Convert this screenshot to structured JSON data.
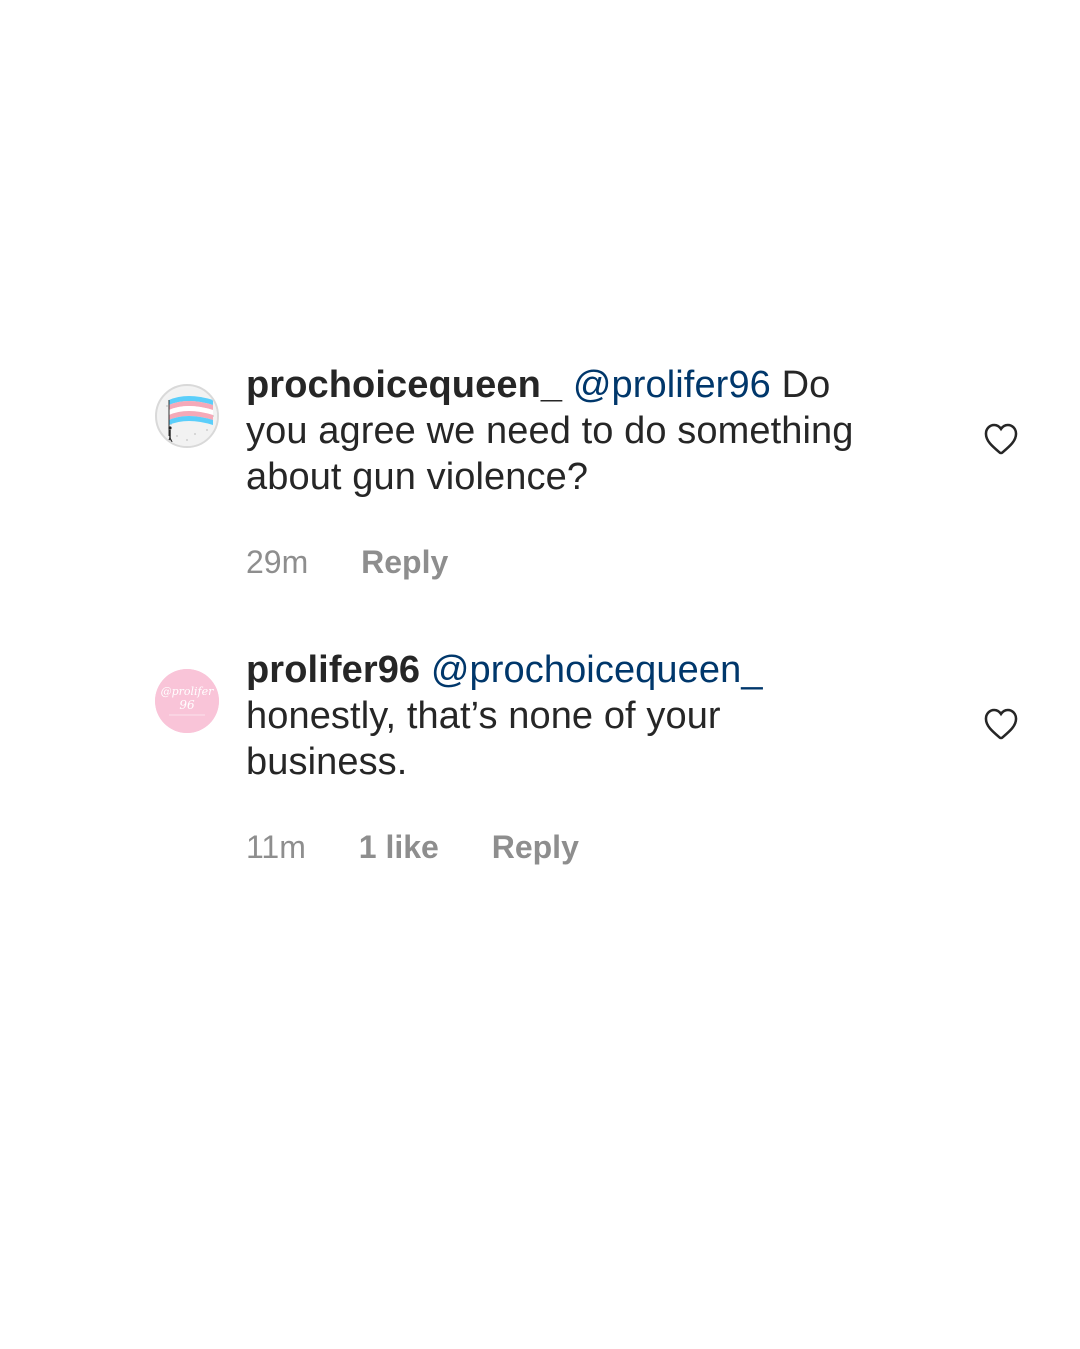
{
  "comments": [
    {
      "username": "prochoicequeen_",
      "mention": "@prolifer96",
      "text_line1_tail": "Do",
      "text_line2": "you agree we need to do something",
      "text_line3": "about gun violence?",
      "time": "29m",
      "reply_label": "Reply",
      "avatar_icon": "trans-flag-avatar-icon",
      "like_icon": "heart-outline-icon"
    },
    {
      "username": "prolifer96",
      "mention": "@prochoicequeen_",
      "text_line2": "honestly, that’s none of your",
      "text_line3": "business.",
      "time": "11m",
      "likes": "1 like",
      "reply_label": "Reply",
      "avatar_icon": "pink-logo-avatar-icon",
      "avatar_text": "@prolifer 96",
      "like_icon": "heart-outline-icon"
    }
  ],
  "colors": {
    "text": "#262626",
    "mention": "#00376b",
    "meta": "#8e8e8e",
    "avatar_pink": "#f9c4d8"
  }
}
